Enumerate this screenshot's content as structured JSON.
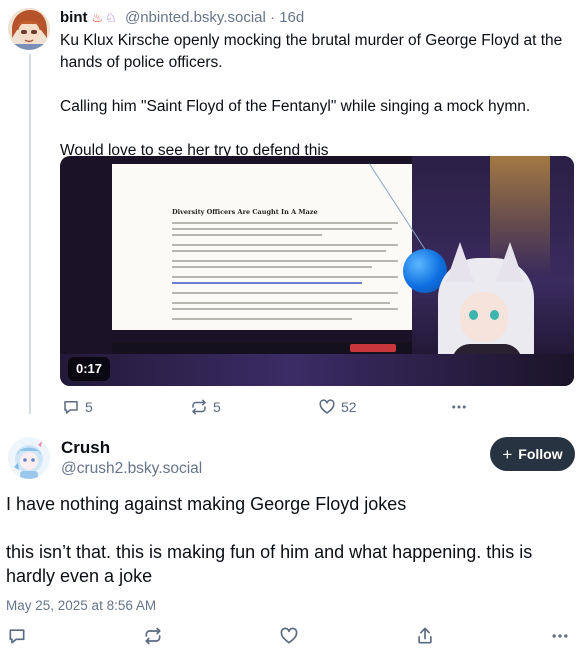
{
  "parent_post": {
    "author_name": "bint",
    "author_handle": "@nbinted.bsky.social",
    "separator": "·",
    "time": "16d",
    "paragraphs": [
      "Ku Klux Kirsche openly mocking the brutal murder of George Floyd at the hands of police officers.",
      "Calling him \"Saint Floyd of the Fentanyl\" while singing a mock hymn.",
      "Would love to see her try to defend this"
    ],
    "video": {
      "duration": "0:17",
      "article_heading": "Diversity Officers Are Caught In A Maze"
    },
    "stats": {
      "replies": "5",
      "reposts": "5",
      "likes": "52"
    }
  },
  "reply_post": {
    "author_name": "Crush",
    "author_handle": "@crush2.bsky.social",
    "follow_label": "Follow",
    "paragraphs": [
      "I have nothing against making George Floyd jokes",
      "this isn’t that. this is making fun of him and what happening. this is hardly even a joke"
    ],
    "date": "May 25, 2025 at 8:56 AM"
  },
  "icons": {
    "reply": "comment-icon",
    "repost": "repost-icon",
    "like": "heart-icon",
    "share": "share-icon",
    "more": "more-horizontal-icon",
    "follow": "plus-icon"
  },
  "colors": {
    "text": "#0b0f14",
    "muted": "#66758a",
    "icon": "#5b6b80",
    "follow_bg": "#273340"
  }
}
